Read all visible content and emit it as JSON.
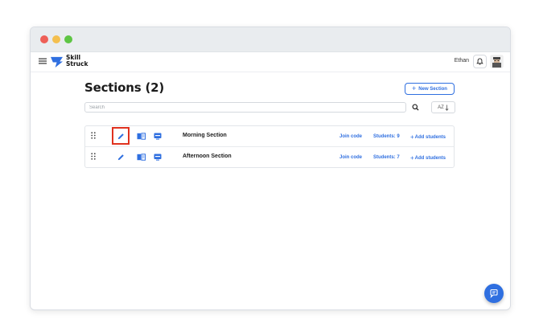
{
  "window": {
    "traffic_lights": {
      "close": "#ee5f57",
      "minimize": "#f4bf4f",
      "maximize": "#5ec544"
    }
  },
  "appbar": {
    "menu_icon": "hamburger-icon",
    "logo_line1": "Skill",
    "logo_line2": "Struck",
    "logo_color": "#2f6fe0",
    "username": "Ethan",
    "bell_icon": "bell-icon",
    "avatar_icon": "avatar-icon"
  },
  "page": {
    "title": "Sections (2)",
    "new_section_label": "New Section",
    "new_section_icon": "plus-icon",
    "search_placeholder": "Search",
    "search_value": "",
    "search_icon": "search-icon",
    "sort_label": "AZ",
    "sort_icon": "sort-alpha-icon"
  },
  "sections": [
    {
      "name": "Morning Section",
      "join_code_label": "Join code",
      "students_label": "Students: 9",
      "add_students_label": "Add students",
      "edit_highlighted": true
    },
    {
      "name": "Afternoon Section",
      "join_code_label": "Join code",
      "students_label": "Students: 7",
      "add_students_label": "Add students",
      "edit_highlighted": false
    }
  ],
  "colors": {
    "accent": "#2f6fe0",
    "highlight_border": "#e0321f"
  },
  "chat_icon": "chat-icon"
}
